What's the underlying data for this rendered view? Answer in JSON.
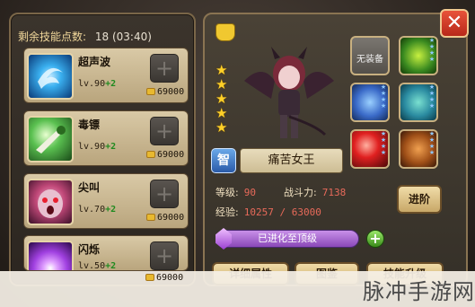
{
  "skill_points": {
    "label": "剩余技能点数:",
    "value": "18 (03:40)"
  },
  "skills": [
    {
      "name": "超声波",
      "level": "lv.90",
      "plus": "+2",
      "cost": "69000",
      "icon": "sonic-wave-icon",
      "color": "#3ab0f0"
    },
    {
      "name": "毒镖",
      "level": "lv.90",
      "plus": "+2",
      "cost": "69000",
      "icon": "poison-dart-icon",
      "color": "#5ac050"
    },
    {
      "name": "尖叫",
      "level": "lv.70",
      "plus": "+2",
      "cost": "69000",
      "icon": "scream-icon",
      "color": "#c04878"
    },
    {
      "name": "闪烁",
      "level": "lv.50",
      "plus": "+2",
      "cost": "69000",
      "icon": "blink-icon",
      "color": "#a040e0"
    }
  ],
  "hero": {
    "badge": "智",
    "name": "痛苦女王",
    "stars": 5,
    "level_label": "等级:",
    "level": "90",
    "power_label": "战斗力:",
    "power": "7138",
    "exp_label": "经验:",
    "exp": "10257 / 63000"
  },
  "equipment": {
    "no_equip": "无装备"
  },
  "buttons": {
    "advance": "进阶",
    "details": "详细属性",
    "gallery": "图鉴",
    "skill_up": "技能升级",
    "close": "✕"
  },
  "evolve_status": "已进化至顶级",
  "watermark": "脉冲手游网"
}
